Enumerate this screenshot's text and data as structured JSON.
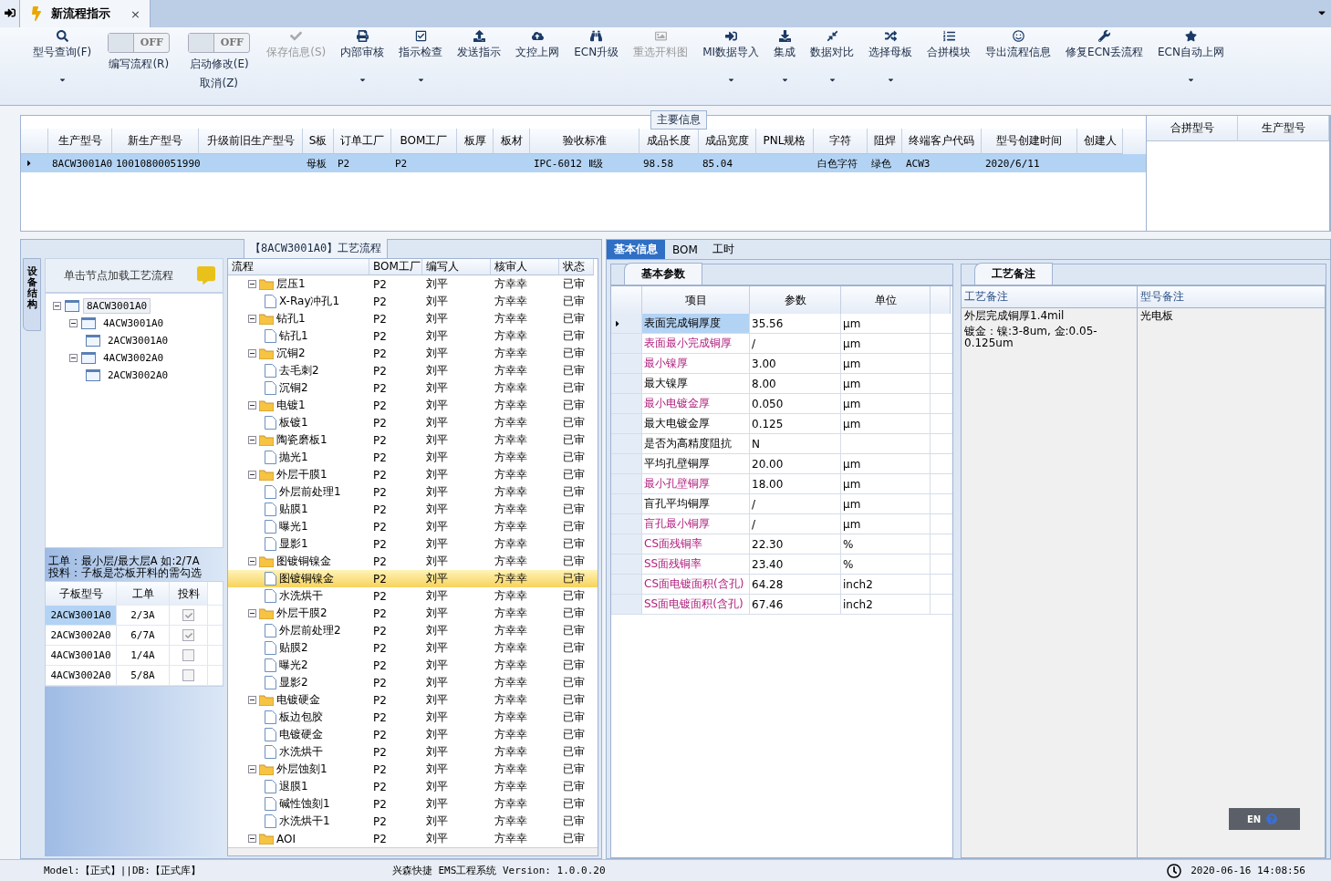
{
  "doc_tab": {
    "title": "新流程指示",
    "close": "×"
  },
  "toolbar": {
    "items": [
      {
        "kind": "button",
        "label": "型号查询(F)",
        "dropdown": true,
        "disabled": false
      },
      {
        "kind": "toggle",
        "label": "编写流程(R)",
        "state": "OFF",
        "on": false
      },
      {
        "kind": "toggle",
        "label": "启动修改(E)",
        "label2": "取消(Z)",
        "state": "OFF",
        "on": false
      },
      {
        "kind": "button",
        "label": "保存信息(S)",
        "dropdown": false,
        "disabled": true
      },
      {
        "kind": "button",
        "label": "内部审核",
        "dropdown": true,
        "disabled": false
      },
      {
        "kind": "button",
        "label": "指示检查",
        "dropdown": true,
        "disabled": false
      },
      {
        "kind": "button",
        "label": "发送指示",
        "dropdown": false,
        "disabled": false
      },
      {
        "kind": "button",
        "label": "文控上网",
        "dropdown": false,
        "disabled": false
      },
      {
        "kind": "button",
        "label": "ECN升级",
        "dropdown": false,
        "disabled": false
      },
      {
        "kind": "button",
        "label": "重选开料图",
        "dropdown": false,
        "disabled": true
      },
      {
        "kind": "button",
        "label": "MI数据导入",
        "dropdown": true,
        "disabled": false
      },
      {
        "kind": "button",
        "label": "集成",
        "dropdown": true,
        "disabled": false
      },
      {
        "kind": "button",
        "label": "数据对比",
        "dropdown": true,
        "disabled": false
      },
      {
        "kind": "button",
        "label": "选择母板",
        "dropdown": true,
        "disabled": false
      },
      {
        "kind": "button",
        "label": "合拼模块",
        "dropdown": false,
        "disabled": false
      },
      {
        "kind": "button",
        "label": "导出流程信息",
        "dropdown": false,
        "disabled": false
      },
      {
        "kind": "button",
        "label": "修复ECN丢流程",
        "dropdown": false,
        "disabled": false
      },
      {
        "kind": "button",
        "label": "ECN自动上网",
        "dropdown": true,
        "disabled": false
      }
    ]
  },
  "main_info": {
    "title": "主要信息",
    "columns": [
      "生产型号",
      "新生产型号",
      "升级前旧生产型号",
      "S板",
      "订单工厂",
      "BOM工厂",
      "板厚",
      "板材",
      "验收标准",
      "成品长度",
      "成品宽度",
      "PNL规格",
      "字符",
      "阻焊",
      "终端客户代码",
      "型号创建时间",
      "创建人"
    ],
    "rows": [
      {
        "selected": true,
        "cells": [
          "8ACW3001A0",
          "10010800051990",
          null,
          "母板",
          "P2",
          "P2",
          null,
          null,
          "IPC-6012 Ⅱ级",
          "98.58",
          "85.04",
          null,
          "白色字符",
          "绿色",
          "ACW3",
          "2020/6/11",
          null
        ]
      }
    ],
    "merge_columns": [
      "合拼型号",
      "生产型号"
    ]
  },
  "process_panel": {
    "title": "【8ACW3001A0】工艺流程",
    "side_tab": "设备结构",
    "hint": "单击节点加载工艺流程",
    "board_tree": [
      {
        "name": "8ACW3001A0",
        "expanded": true,
        "selected": true,
        "children": [
          {
            "name": "4ACW3001A0",
            "expanded": true,
            "selected": false,
            "children": [
              {
                "name": "2ACW3001A0",
                "selected": false
              }
            ]
          },
          {
            "name": "4ACW3002A0",
            "expanded": true,
            "selected": false,
            "children": [
              {
                "name": "2ACW3002A0",
                "selected": false
              }
            ]
          }
        ]
      }
    ],
    "notes": [
      "工单：最小层/最大层A 如:2/7A",
      "投料：子板是芯板开料的需勾选"
    ],
    "sub_boards": {
      "columns": [
        "子板型号",
        "工单",
        "投料"
      ],
      "rows": [
        {
          "model": "2ACW3001A0",
          "order": "2/3A",
          "feed": true,
          "selected": true
        },
        {
          "model": "2ACW3002A0",
          "order": "6/7A",
          "feed": true,
          "selected": false
        },
        {
          "model": "4ACW3001A0",
          "order": "1/4A",
          "feed": false,
          "selected": false
        },
        {
          "model": "4ACW3002A0",
          "order": "5/8A",
          "feed": false,
          "selected": false
        }
      ]
    },
    "flow": {
      "columns": [
        "流程",
        "BOM工厂",
        "编写人",
        "核审人",
        "状态"
      ],
      "groups": [
        {
          "name": "层压1",
          "bom": "P2",
          "writer": "刘平",
          "reviewer": "方幸幸",
          "status": "已审",
          "expanded": true,
          "selected": false,
          "children": [
            {
              "name": "X-Ray冲孔1",
              "bom": "P2",
              "writer": "刘平",
              "reviewer": "方幸幸",
              "status": "已审",
              "selected": false
            }
          ]
        },
        {
          "name": "钻孔1",
          "bom": "P2",
          "writer": "刘平",
          "reviewer": "方幸幸",
          "status": "已审",
          "expanded": true,
          "selected": false,
          "children": [
            {
              "name": "钻孔1",
              "bom": "P2",
              "writer": "刘平",
              "reviewer": "方幸幸",
              "status": "已审",
              "selected": false
            }
          ]
        },
        {
          "name": "沉铜2",
          "bom": "P2",
          "writer": "刘平",
          "reviewer": "方幸幸",
          "status": "已审",
          "expanded": true,
          "selected": false,
          "children": [
            {
              "name": "去毛刺2",
              "bom": "P2",
              "writer": "刘平",
              "reviewer": "方幸幸",
              "status": "已审",
              "selected": false
            },
            {
              "name": "沉铜2",
              "bom": "P2",
              "writer": "刘平",
              "reviewer": "方幸幸",
              "status": "已审",
              "selected": false
            }
          ]
        },
        {
          "name": "电镀1",
          "bom": "P2",
          "writer": "刘平",
          "reviewer": "方幸幸",
          "status": "已审",
          "expanded": true,
          "selected": false,
          "children": [
            {
              "name": "板镀1",
              "bom": "P2",
              "writer": "刘平",
              "reviewer": "方幸幸",
              "status": "已审",
              "selected": false
            }
          ]
        },
        {
          "name": "陶瓷磨板1",
          "bom": "P2",
          "writer": "刘平",
          "reviewer": "方幸幸",
          "status": "已审",
          "expanded": true,
          "selected": false,
          "children": [
            {
              "name": "抛光1",
              "bom": "P2",
              "writer": "刘平",
              "reviewer": "方幸幸",
              "status": "已审",
              "selected": false
            }
          ]
        },
        {
          "name": "外层干膜1",
          "bom": "P2",
          "writer": "刘平",
          "reviewer": "方幸幸",
          "status": "已审",
          "expanded": true,
          "selected": false,
          "children": [
            {
              "name": "外层前处理1",
              "bom": "P2",
              "writer": "刘平",
              "reviewer": "方幸幸",
              "status": "已审",
              "selected": false
            },
            {
              "name": "贴膜1",
              "bom": "P2",
              "writer": "刘平",
              "reviewer": "方幸幸",
              "status": "已审",
              "selected": false
            },
            {
              "name": "曝光1",
              "bom": "P2",
              "writer": "刘平",
              "reviewer": "方幸幸",
              "status": "已审",
              "selected": false
            },
            {
              "name": "显影1",
              "bom": "P2",
              "writer": "刘平",
              "reviewer": "方幸幸",
              "status": "已审",
              "selected": false
            }
          ]
        },
        {
          "name": "图镀铜镍金",
          "bom": "P2",
          "writer": "刘平",
          "reviewer": "方幸幸",
          "status": "已审",
          "expanded": true,
          "selected": false,
          "children": [
            {
              "name": "图镀铜镍金",
              "bom": "P2",
              "writer": "刘平",
              "reviewer": "方幸幸",
              "status": "已审",
              "selected": true
            },
            {
              "name": "水洗烘干",
              "bom": "P2",
              "writer": "刘平",
              "reviewer": "方幸幸",
              "status": "已审",
              "selected": false
            }
          ]
        },
        {
          "name": "外层干膜2",
          "bom": "P2",
          "writer": "刘平",
          "reviewer": "方幸幸",
          "status": "已审",
          "expanded": true,
          "selected": false,
          "children": [
            {
              "name": "外层前处理2",
              "bom": "P2",
              "writer": "刘平",
              "reviewer": "方幸幸",
              "status": "已审",
              "selected": false
            },
            {
              "name": "贴膜2",
              "bom": "P2",
              "writer": "刘平",
              "reviewer": "方幸幸",
              "status": "已审",
              "selected": false
            },
            {
              "name": "曝光2",
              "bom": "P2",
              "writer": "刘平",
              "reviewer": "方幸幸",
              "status": "已审",
              "selected": false
            },
            {
              "name": "显影2",
              "bom": "P2",
              "writer": "刘平",
              "reviewer": "方幸幸",
              "status": "已审",
              "selected": false
            }
          ]
        },
        {
          "name": "电镀硬金",
          "bom": "P2",
          "writer": "刘平",
          "reviewer": "方幸幸",
          "status": "已审",
          "expanded": true,
          "selected": false,
          "children": [
            {
              "name": "板边包胶",
              "bom": "P2",
              "writer": "刘平",
              "reviewer": "方幸幸",
              "status": "已审",
              "selected": false
            },
            {
              "name": "电镀硬金",
              "bom": "P2",
              "writer": "刘平",
              "reviewer": "方幸幸",
              "status": "已审",
              "selected": false
            },
            {
              "name": "水洗烘干",
              "bom": "P2",
              "writer": "刘平",
              "reviewer": "方幸幸",
              "status": "已审",
              "selected": false
            }
          ]
        },
        {
          "name": "外层蚀刻1",
          "bom": "P2",
          "writer": "刘平",
          "reviewer": "方幸幸",
          "status": "已审",
          "expanded": true,
          "selected": false,
          "children": [
            {
              "name": "退膜1",
              "bom": "P2",
              "writer": "刘平",
              "reviewer": "方幸幸",
              "status": "已审",
              "selected": false
            },
            {
              "name": "碱性蚀刻1",
              "bom": "P2",
              "writer": "刘平",
              "reviewer": "方幸幸",
              "status": "已审",
              "selected": false
            },
            {
              "name": "水洗烘干1",
              "bom": "P2",
              "writer": "刘平",
              "reviewer": "方幸幸",
              "status": "已审",
              "selected": false
            }
          ]
        },
        {
          "name": "AOI",
          "bom": "P2",
          "writer": "刘平",
          "reviewer": "方幸幸",
          "status": "已审",
          "expanded": true,
          "selected": false
        }
      ]
    }
  },
  "detail": {
    "tabs": [
      {
        "label": "基本信息",
        "selected": true
      },
      {
        "label": "BOM",
        "selected": false
      },
      {
        "label": "工时",
        "selected": false
      }
    ],
    "params": {
      "title": "基本参数",
      "columns": [
        "项目",
        "参数",
        "单位"
      ],
      "rows": [
        {
          "item": "表面完成铜厚度",
          "value": "35.56",
          "unit": "μm",
          "required": false,
          "selected": true
        },
        {
          "item": "表面最小完成铜厚",
          "value": "/",
          "unit": "μm",
          "required": true,
          "selected": false
        },
        {
          "item": "最小镍厚",
          "value": "3.00",
          "unit": "μm",
          "required": true,
          "selected": false
        },
        {
          "item": "最大镍厚",
          "value": "8.00",
          "unit": "μm",
          "required": false,
          "selected": false
        },
        {
          "item": "最小电镀金厚",
          "value": "0.050",
          "unit": "μm",
          "required": true,
          "selected": false
        },
        {
          "item": "最大电镀金厚",
          "value": "0.125",
          "unit": "μm",
          "required": false,
          "selected": false
        },
        {
          "item": "是否为高精度阻抗",
          "value": "N",
          "unit": null,
          "required": false,
          "selected": false
        },
        {
          "item": "平均孔壁铜厚",
          "value": "20.00",
          "unit": "μm",
          "required": false,
          "selected": false
        },
        {
          "item": "最小孔壁铜厚",
          "value": "18.00",
          "unit": "μm",
          "required": true,
          "selected": false
        },
        {
          "item": "盲孔平均铜厚",
          "value": "/",
          "unit": "μm",
          "required": false,
          "selected": false
        },
        {
          "item": "盲孔最小铜厚",
          "value": "/",
          "unit": "μm",
          "required": true,
          "selected": false
        },
        {
          "item": "CS面残铜率",
          "value": "22.30",
          "unit": "%",
          "required": true,
          "selected": false
        },
        {
          "item": "SS面残铜率",
          "value": "23.40",
          "unit": "%",
          "required": true,
          "selected": false
        },
        {
          "item": "CS面电镀面积(含孔)",
          "value": "64.28",
          "unit": "inch2",
          "required": true,
          "selected": false
        },
        {
          "item": "SS面电镀面积(含孔)",
          "value": "67.46",
          "unit": "inch2",
          "required": true,
          "selected": false
        }
      ]
    },
    "remarks": {
      "title": "工艺备注",
      "columns": [
        {
          "header": "工艺备注",
          "lines": [
            "外层完成铜厚1.4mil",
            "镀金：镍:3-8um, 金:0.05-0.125um"
          ]
        },
        {
          "header": "型号备注",
          "lines": [
            "光电板"
          ]
        }
      ]
    }
  },
  "ime": {
    "label": "EN"
  },
  "status_bar": {
    "model": "Model:【正式】||DB:【正式库】",
    "app": "兴森快捷 EMS工程系统 Version: 1.0.0.20",
    "time": "2020-06-16 14:08:56"
  }
}
